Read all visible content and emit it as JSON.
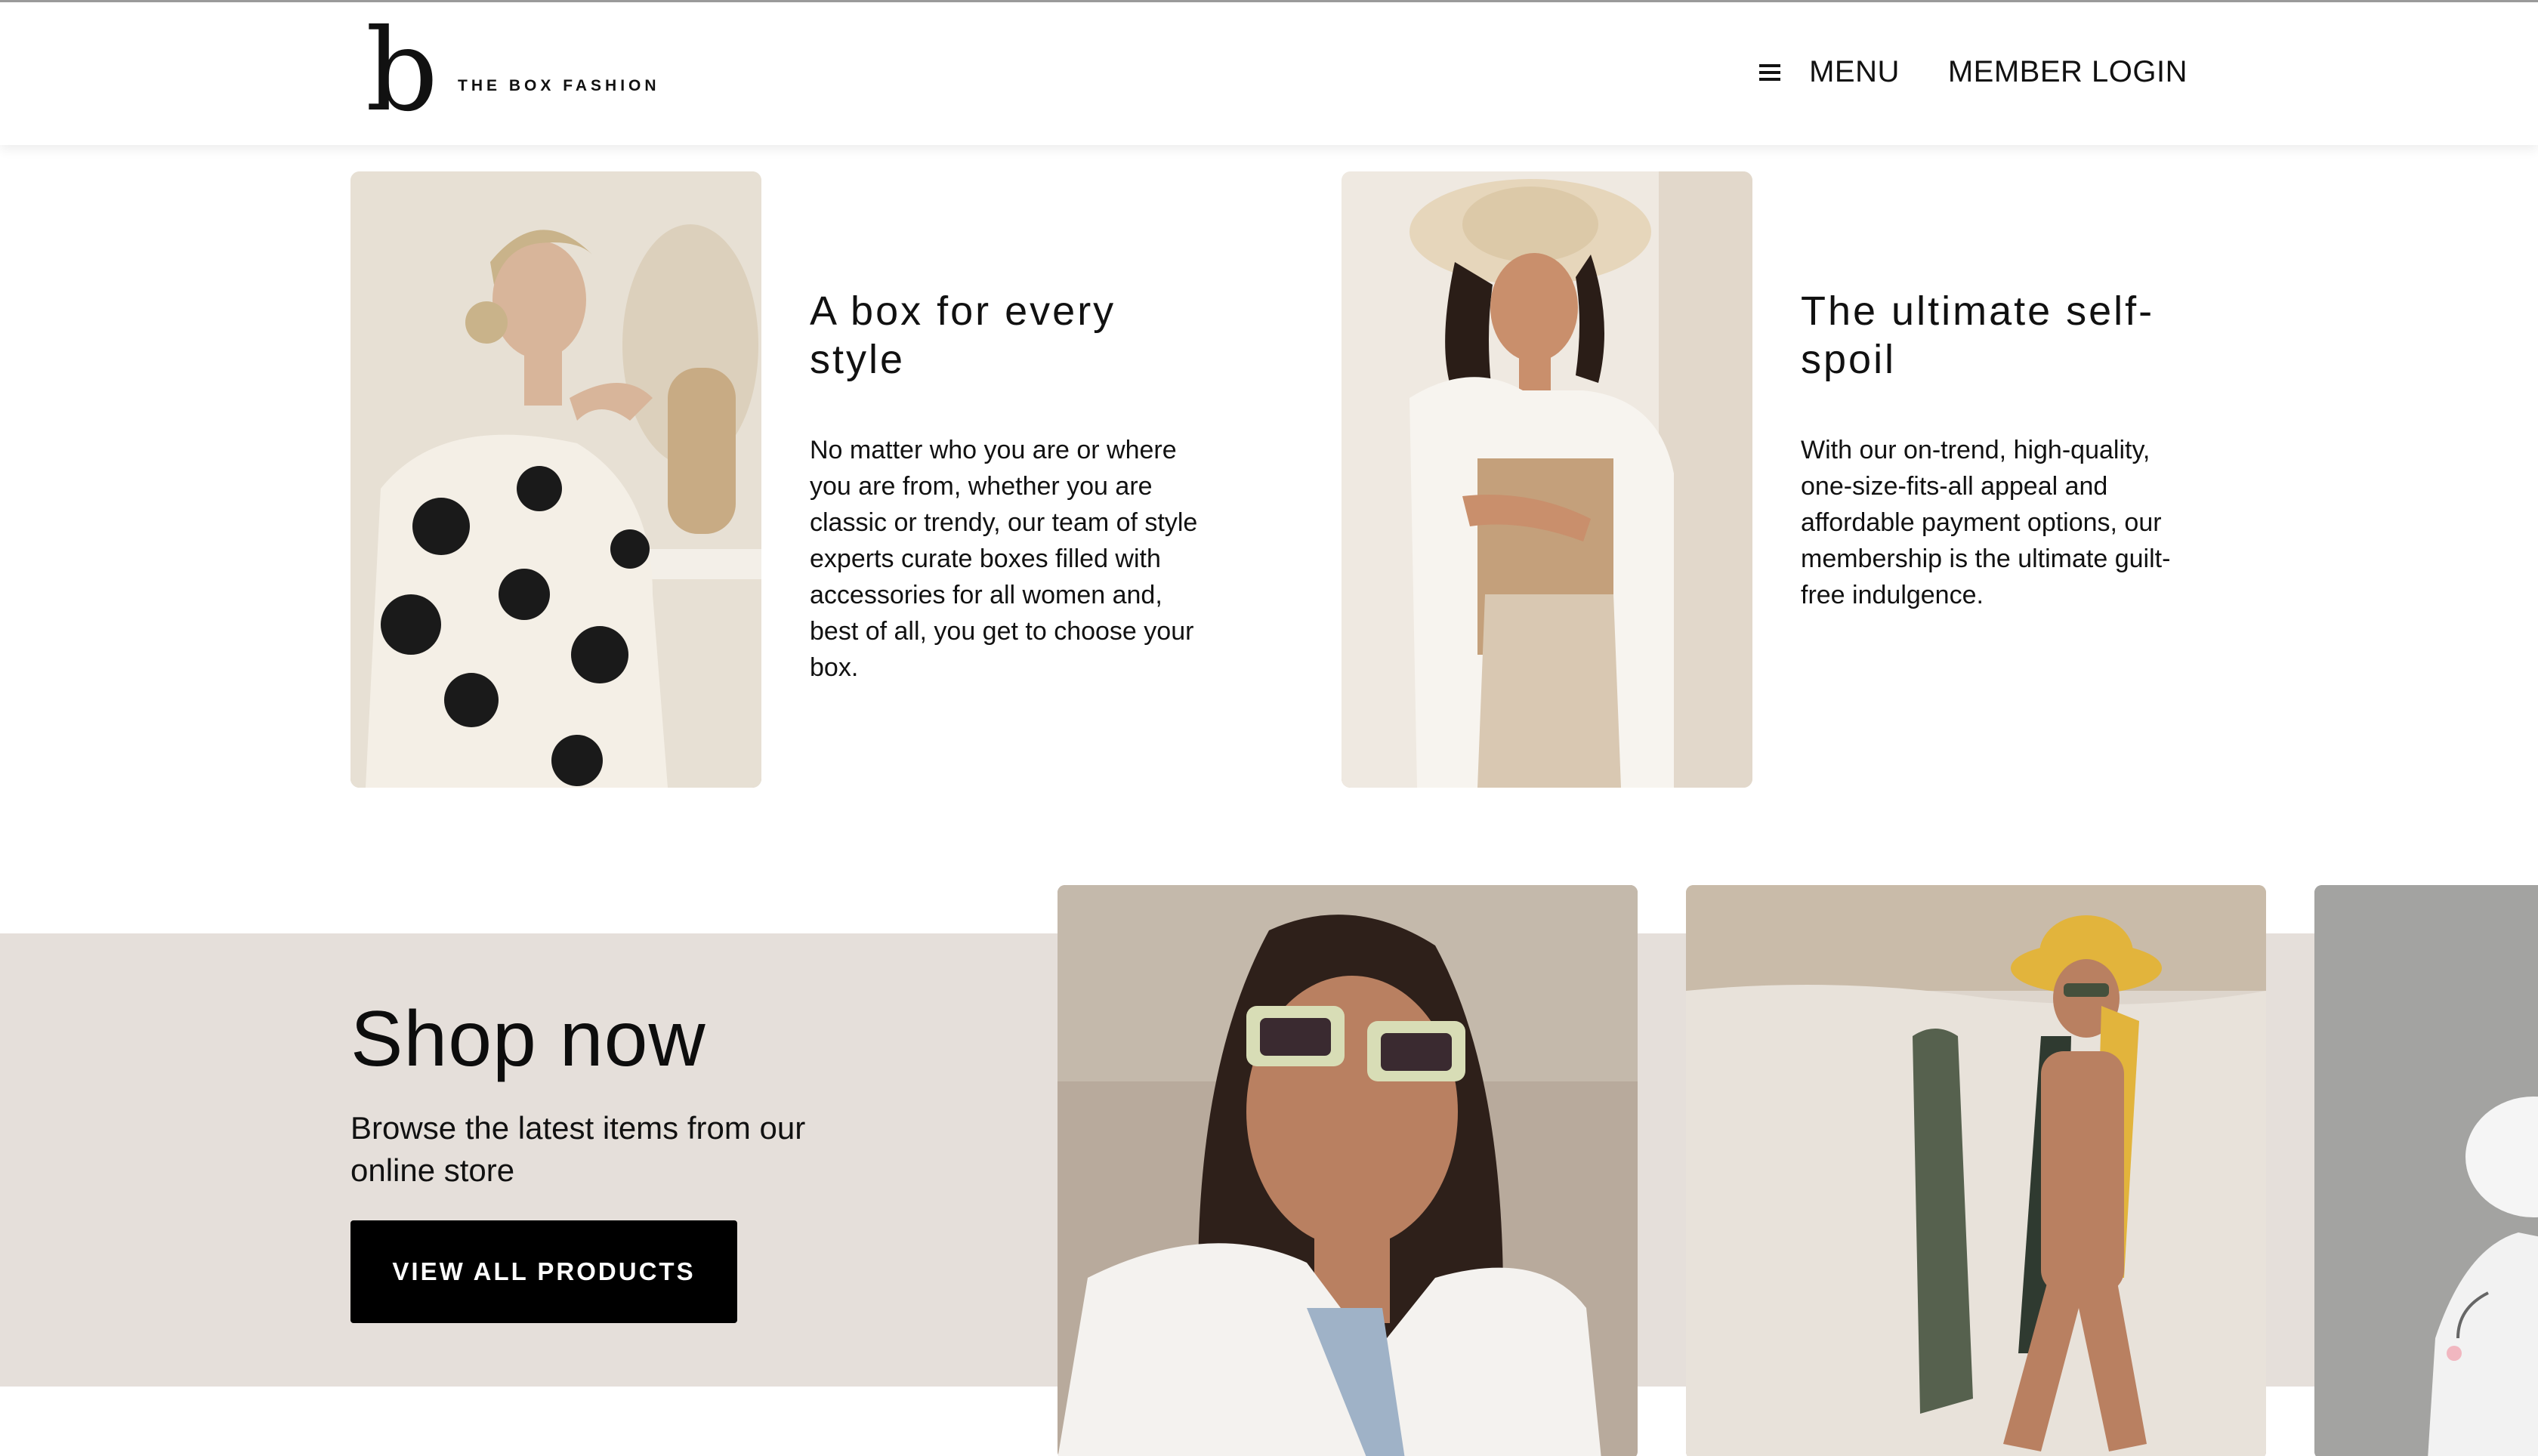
{
  "header": {
    "brand_mark": "b",
    "brand_name": "THE BOX FASHION",
    "menu_label": "MENU",
    "login_label": "MEMBER LOGIN"
  },
  "features": [
    {
      "title": "A box for every style",
      "body": "No matter who you are or where you are from, whether you are classic or trendy, our team of style experts curate boxes filled with accessories for all women and, best of all, you get to choose your box."
    },
    {
      "title": "The ultimate self-spoil",
      "body": "With our on-trend, high-quality, one-size-fits-all appeal and affordable payment options, our membership is the ultimate guilt-free indulgence."
    }
  ],
  "shop": {
    "title": "Shop now",
    "subtitle": "Browse the latest items from our online store",
    "button_label": "VIEW ALL PRODUCTS"
  },
  "colors": {
    "band_background": "#e5dfda",
    "button_background": "#000000",
    "text": "#111111"
  }
}
